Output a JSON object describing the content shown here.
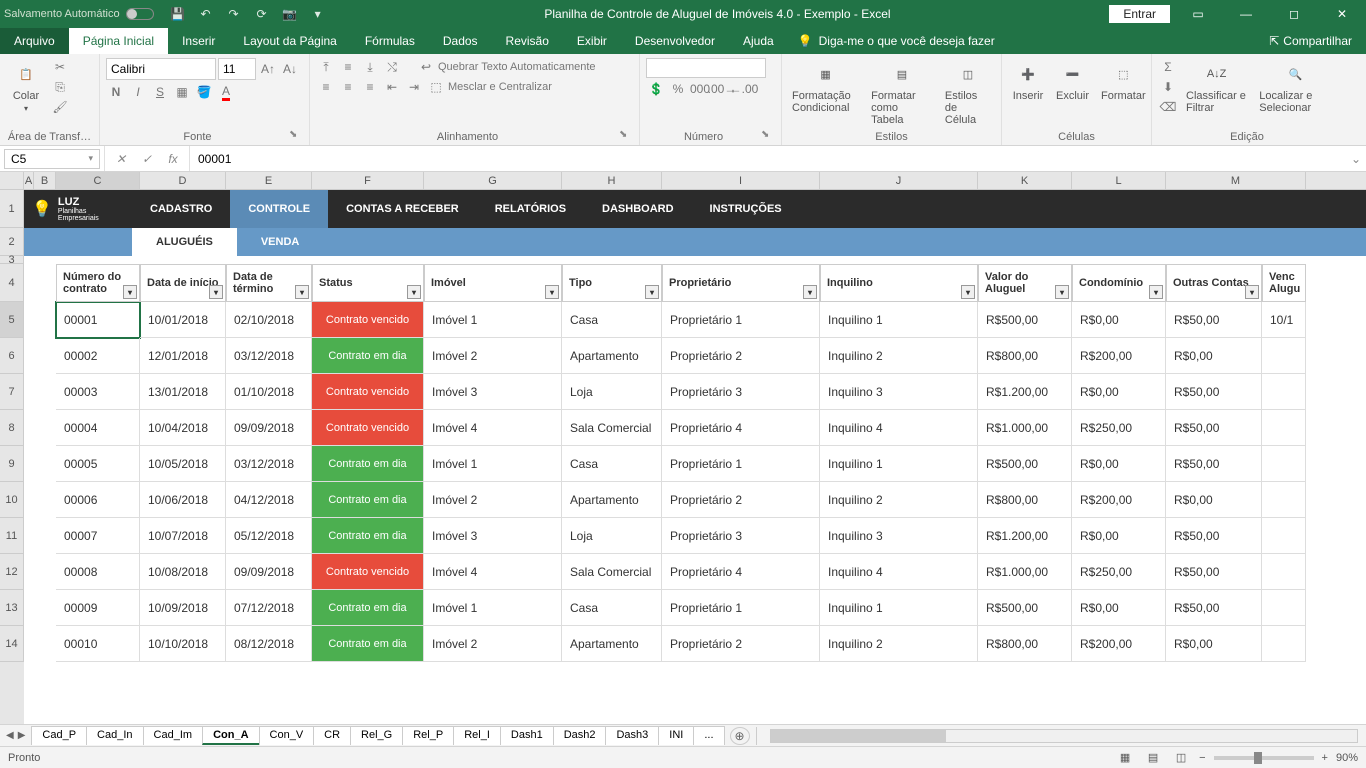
{
  "titlebar": {
    "autosave": "Salvamento Automático",
    "title": "Planilha de Controle de Aluguel de Imóveis 4.0 - Exemplo  -  Excel",
    "entrar": "Entrar"
  },
  "tabs": {
    "file": "Arquivo",
    "home": "Página Inicial",
    "insert": "Inserir",
    "layout": "Layout da Página",
    "formulas": "Fórmulas",
    "data": "Dados",
    "review": "Revisão",
    "view": "Exibir",
    "developer": "Desenvolvedor",
    "help": "Ajuda",
    "tellme": "Diga-me o que você deseja fazer",
    "share": "Compartilhar"
  },
  "ribbon": {
    "clipboard": {
      "title": "Área de Transf…",
      "paste": "Colar"
    },
    "font": {
      "title": "Fonte",
      "name": "Calibri",
      "size": "11"
    },
    "align": {
      "title": "Alinhamento",
      "wrap": "Quebrar Texto Automaticamente",
      "merge": "Mesclar e Centralizar"
    },
    "number": {
      "title": "Número"
    },
    "styles": {
      "title": "Estilos",
      "condfmt": "Formatação Condicional",
      "table": "Formatar como Tabela",
      "cellstyles": "Estilos de Célula"
    },
    "cells": {
      "title": "Células",
      "insert": "Inserir",
      "delete": "Excluir",
      "format": "Formatar"
    },
    "editing": {
      "title": "Edição",
      "sort": "Classificar e Filtrar",
      "find": "Localizar e Selecionar"
    }
  },
  "namebox": "C5",
  "formula": "00001",
  "cols": [
    "A",
    "B",
    "C",
    "D",
    "E",
    "F",
    "G",
    "H",
    "I",
    "J",
    "K",
    "L",
    "M"
  ],
  "nav": {
    "logo": "LUZ",
    "logo_sub": "Planilhas Empresariais",
    "items": [
      "CADASTRO",
      "CONTROLE",
      "CONTAS A RECEBER",
      "RELATÓRIOS",
      "DASHBOARD",
      "INSTRUÇÕES"
    ]
  },
  "subnav": [
    "ALUGUÉIS",
    "VENDA"
  ],
  "headers": {
    "num": "Número do contrato",
    "di": "Data de início",
    "dt": "Data de término",
    "status": "Status",
    "imovel": "Imóvel",
    "tipo": "Tipo",
    "prop": "Proprietário",
    "inq": "Inquilino",
    "valor": "Valor do Aluguel",
    "cond": "Condomínio",
    "outras": "Outras Contas",
    "venc": "Venc Alugu"
  },
  "rows": [
    {
      "num": "00001",
      "di": "10/01/2018",
      "dt": "02/10/2018",
      "status": "Contrato vencido",
      "st": "red",
      "imovel": "Imóvel 1",
      "tipo": "Casa",
      "prop": "Proprietário 1",
      "inq": "Inquilino 1",
      "valor": "R$500,00",
      "cond": "R$0,00",
      "outras": "R$50,00",
      "venc": "10/1"
    },
    {
      "num": "00002",
      "di": "12/01/2018",
      "dt": "03/12/2018",
      "status": "Contrato em dia",
      "st": "green",
      "imovel": "Imóvel 2",
      "tipo": "Apartamento",
      "prop": "Proprietário 2",
      "inq": "Inquilino 2",
      "valor": "R$800,00",
      "cond": "R$200,00",
      "outras": "R$0,00",
      "venc": ""
    },
    {
      "num": "00003",
      "di": "13/01/2018",
      "dt": "01/10/2018",
      "status": "Contrato vencido",
      "st": "red",
      "imovel": "Imóvel 3",
      "tipo": "Loja",
      "prop": "Proprietário 3",
      "inq": "Inquilino 3",
      "valor": "R$1.200,00",
      "cond": "R$0,00",
      "outras": "R$50,00",
      "venc": ""
    },
    {
      "num": "00004",
      "di": "10/04/2018",
      "dt": "09/09/2018",
      "status": "Contrato vencido",
      "st": "red",
      "imovel": "Imóvel 4",
      "tipo": "Sala Comercial",
      "prop": "Proprietário 4",
      "inq": "Inquilino 4",
      "valor": "R$1.000,00",
      "cond": "R$250,00",
      "outras": "R$50,00",
      "venc": ""
    },
    {
      "num": "00005",
      "di": "10/05/2018",
      "dt": "03/12/2018",
      "status": "Contrato em dia",
      "st": "green",
      "imovel": "Imóvel 1",
      "tipo": "Casa",
      "prop": "Proprietário 1",
      "inq": "Inquilino 1",
      "valor": "R$500,00",
      "cond": "R$0,00",
      "outras": "R$50,00",
      "venc": ""
    },
    {
      "num": "00006",
      "di": "10/06/2018",
      "dt": "04/12/2018",
      "status": "Contrato em dia",
      "st": "green",
      "imovel": "Imóvel 2",
      "tipo": "Apartamento",
      "prop": "Proprietário 2",
      "inq": "Inquilino 2",
      "valor": "R$800,00",
      "cond": "R$200,00",
      "outras": "R$0,00",
      "venc": ""
    },
    {
      "num": "00007",
      "di": "10/07/2018",
      "dt": "05/12/2018",
      "status": "Contrato em dia",
      "st": "green",
      "imovel": "Imóvel 3",
      "tipo": "Loja",
      "prop": "Proprietário 3",
      "inq": "Inquilino 3",
      "valor": "R$1.200,00",
      "cond": "R$0,00",
      "outras": "R$50,00",
      "venc": ""
    },
    {
      "num": "00008",
      "di": "10/08/2018",
      "dt": "09/09/2018",
      "status": "Contrato vencido",
      "st": "red",
      "imovel": "Imóvel 4",
      "tipo": "Sala Comercial",
      "prop": "Proprietário 4",
      "inq": "Inquilino 4",
      "valor": "R$1.000,00",
      "cond": "R$250,00",
      "outras": "R$50,00",
      "venc": ""
    },
    {
      "num": "00009",
      "di": "10/09/2018",
      "dt": "07/12/2018",
      "status": "Contrato em dia",
      "st": "green",
      "imovel": "Imóvel 1",
      "tipo": "Casa",
      "prop": "Proprietário 1",
      "inq": "Inquilino 1",
      "valor": "R$500,00",
      "cond": "R$0,00",
      "outras": "R$50,00",
      "venc": ""
    },
    {
      "num": "00010",
      "di": "10/10/2018",
      "dt": "08/12/2018",
      "status": "Contrato em dia",
      "st": "green",
      "imovel": "Imóvel 2",
      "tipo": "Apartamento",
      "prop": "Proprietário 2",
      "inq": "Inquilino 2",
      "valor": "R$800,00",
      "cond": "R$200,00",
      "outras": "R$0,00",
      "venc": ""
    }
  ],
  "sheets": [
    "Cad_P",
    "Cad_In",
    "Cad_Im",
    "Con_A",
    "Con_V",
    "CR",
    "Rel_G",
    "Rel_P",
    "Rel_I",
    "Dash1",
    "Dash2",
    "Dash3",
    "INI",
    "..."
  ],
  "active_sheet": "Con_A",
  "statusbar": {
    "ready": "Pronto",
    "zoom": "90%"
  }
}
